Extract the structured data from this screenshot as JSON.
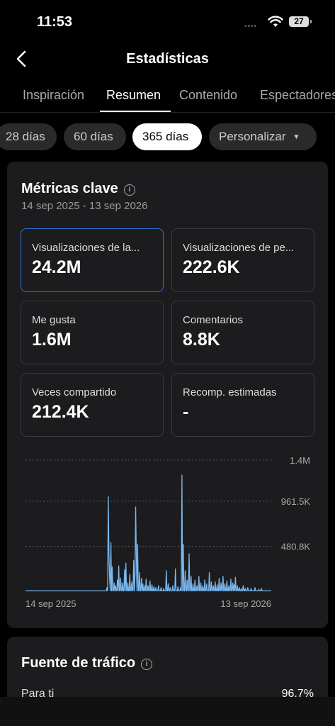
{
  "status": {
    "time": "11:53",
    "battery": "27"
  },
  "header": {
    "title": "Estadísticas"
  },
  "tabs": [
    {
      "label": "Inspiración",
      "active": false
    },
    {
      "label": "Resumen",
      "active": true
    },
    {
      "label": "Contenido",
      "active": false
    },
    {
      "label": "Espectadores",
      "active": false
    }
  ],
  "periods": [
    {
      "label": "28 días",
      "active": false
    },
    {
      "label": "60 días",
      "active": false
    },
    {
      "label": "365 días",
      "active": true
    },
    {
      "label": "Personalizar",
      "active": false
    }
  ],
  "metrics": {
    "title": "Métricas clave",
    "date_range": "14 sep 2025 - 13 sep 2026",
    "tiles": [
      {
        "label": "Visualizaciones de la...",
        "value": "24.2M"
      },
      {
        "label": "Visualizaciones de pe...",
        "value": "222.6K"
      },
      {
        "label": "Me gusta",
        "value": "1.6M"
      },
      {
        "label": "Comentarios",
        "value": "8.8K"
      },
      {
        "label": "Veces compartido",
        "value": "212.4K"
      },
      {
        "label": "Recomp. estimadas",
        "value": "-"
      }
    ]
  },
  "chart_data": {
    "type": "line",
    "y_ticks": [
      "1.4M",
      "961.5K",
      "480.8K"
    ],
    "x_labels": [
      "14 sep 2025",
      "13 sep 2026"
    ],
    "ylim": [
      0,
      1400000
    ],
    "values": [
      5000,
      5000,
      5000,
      5000,
      5000,
      5000,
      5000,
      5000,
      5000,
      5000,
      5000,
      5000,
      5000,
      5000,
      5000,
      5000,
      5000,
      5000,
      5000,
      5000,
      5000,
      5000,
      5000,
      5000,
      5000,
      5000,
      5000,
      5000,
      5000,
      5000,
      5000,
      5000,
      5000,
      5000,
      5000,
      5000,
      5000,
      5000,
      5000,
      5000,
      5000,
      5000,
      5000,
      5000,
      5000,
      5000,
      5000,
      5000,
      5000,
      5000,
      5000,
      5000,
      5000,
      5000,
      5000,
      5000,
      5000,
      5000,
      5000,
      5000,
      5000,
      5000,
      5000,
      5000,
      5000,
      5000,
      5000,
      5000,
      5000,
      5000,
      5000,
      5000,
      5000,
      5000,
      5000,
      5000,
      5000,
      5000,
      5000,
      5000,
      5000,
      5000,
      5000,
      5000,
      5000,
      5000,
      5000,
      5000,
      5000,
      5000,
      5000,
      5000,
      5000,
      5000,
      5000,
      5000,
      5000,
      5000,
      5000,
      5000,
      5000,
      5000,
      5000,
      5000,
      5000,
      5000,
      5000,
      5000,
      5000,
      5000,
      5000,
      5000,
      5000,
      5000,
      5000,
      5000,
      5000,
      5000,
      5000,
      5000,
      5000,
      5000,
      5000,
      5000,
      5000,
      5000,
      5000,
      5000,
      5000,
      5000,
      5000,
      5000,
      5000,
      5000,
      5000,
      5000,
      5000,
      5000,
      5000,
      5000,
      5000,
      5000,
      5000,
      5000,
      5000,
      5000,
      5000,
      5000,
      5000,
      5000,
      5000,
      5000,
      5000,
      5000,
      5000,
      5000,
      5000,
      5000,
      5000,
      5000,
      5000,
      5000,
      5000,
      5000,
      5000,
      5000,
      5000,
      5000,
      5000,
      5000,
      5000,
      5000,
      5000,
      5000,
      5000,
      5000,
      5000,
      5000,
      5000,
      5000,
      5000,
      5000,
      5000,
      5000,
      5000,
      5000,
      5000,
      5000,
      5000,
      5000,
      5000,
      5000,
      5000,
      5000,
      5000,
      5000,
      5000,
      5000,
      5000,
      5000,
      5000,
      5000,
      5000,
      5000,
      5000,
      5000,
      5000,
      5000,
      5000,
      5000,
      5000,
      5000,
      5000,
      5000,
      5000,
      5000,
      5000,
      5000,
      5000,
      5000,
      5000,
      5000,
      5000,
      5000,
      5000,
      5000,
      5000,
      5000,
      5000,
      5000,
      5000,
      5000,
      5000,
      5000,
      5000,
      5000,
      5000,
      5000,
      5000,
      5000,
      5000,
      5000,
      5000,
      5000,
      5000,
      5000,
      5000,
      5000,
      5000,
      5000,
      5000,
      5000,
      5000,
      5000,
      5000,
      5000,
      5000,
      5000,
      5000,
      5000,
      5000,
      5000,
      5000,
      5000,
      5000,
      5000,
      5000,
      5000,
      5000,
      5000,
      5000,
      5000,
      5000,
      5000,
      5000,
      5000,
      5000,
      5000,
      5000,
      5000,
      5000,
      5000,
      5000,
      5000,
      5000,
      5000,
      5000,
      5000,
      5000,
      5000,
      5000,
      5000,
      5000,
      5000,
      5000,
      5000,
      5000,
      5000,
      5000,
      5000,
      5000,
      5000,
      5000,
      5000,
      5000,
      5000,
      5000,
      5000,
      5000,
      5000,
      5000,
      5000,
      5000,
      5000,
      5000,
      5000,
      5000,
      5000,
      5000,
      5000,
      5000,
      5000,
      5000,
      5000,
      5000,
      5000,
      5000,
      5000,
      5000,
      5000,
      5000,
      5000,
      5000,
      5000,
      5000,
      5000,
      5000,
      5000,
      5000,
      5000,
      5000,
      5000,
      5000,
      5000,
      5000,
      5000,
      5000,
      5000,
      5000,
      5000,
      5000,
      5000,
      5000,
      5000,
      5000,
      5000,
      5000,
      5000,
      5000,
      5000,
      5000,
      5000,
      5000,
      5000,
      5000,
      5000,
      5000,
      5000,
      5000,
      5000,
      5000,
      5000,
      5000,
      5000,
      5000,
      5000,
      5000,
      5000
    ],
    "peaks": [
      {
        "day": 125,
        "v": 40000
      },
      {
        "day": 127,
        "v": 1010000
      },
      {
        "day": 128,
        "v": 380000
      },
      {
        "day": 129,
        "v": 150000
      },
      {
        "day": 131,
        "v": 520000
      },
      {
        "day": 133,
        "v": 260000
      },
      {
        "day": 136,
        "v": 90000
      },
      {
        "day": 138,
        "v": 60000
      },
      {
        "day": 141,
        "v": 120000
      },
      {
        "day": 143,
        "v": 270000
      },
      {
        "day": 146,
        "v": 140000
      },
      {
        "day": 149,
        "v": 90000
      },
      {
        "day": 152,
        "v": 230000
      },
      {
        "day": 154,
        "v": 300000
      },
      {
        "day": 157,
        "v": 90000
      },
      {
        "day": 160,
        "v": 180000
      },
      {
        "day": 163,
        "v": 100000
      },
      {
        "day": 166,
        "v": 330000
      },
      {
        "day": 168,
        "v": 180000
      },
      {
        "day": 169,
        "v": 900000
      },
      {
        "day": 170,
        "v": 400000
      },
      {
        "day": 172,
        "v": 500000
      },
      {
        "day": 175,
        "v": 200000
      },
      {
        "day": 178,
        "v": 140000
      },
      {
        "day": 180,
        "v": 80000
      },
      {
        "day": 183,
        "v": 60000
      },
      {
        "day": 185,
        "v": 130000
      },
      {
        "day": 188,
        "v": 60000
      },
      {
        "day": 191,
        "v": 110000
      },
      {
        "day": 194,
        "v": 70000
      },
      {
        "day": 197,
        "v": 50000
      },
      {
        "day": 200,
        "v": 40000
      },
      {
        "day": 204,
        "v": 60000
      },
      {
        "day": 208,
        "v": 40000
      },
      {
        "day": 212,
        "v": 30000
      },
      {
        "day": 216,
        "v": 220000
      },
      {
        "day": 219,
        "v": 80000
      },
      {
        "day": 222,
        "v": 40000
      },
      {
        "day": 226,
        "v": 60000
      },
      {
        "day": 230,
        "v": 240000
      },
      {
        "day": 234,
        "v": 50000
      },
      {
        "day": 238,
        "v": 40000
      },
      {
        "day": 240,
        "v": 1240000
      },
      {
        "day": 242,
        "v": 500000
      },
      {
        "day": 245,
        "v": 220000
      },
      {
        "day": 248,
        "v": 120000
      },
      {
        "day": 251,
        "v": 400000
      },
      {
        "day": 254,
        "v": 160000
      },
      {
        "day": 257,
        "v": 80000
      },
      {
        "day": 260,
        "v": 120000
      },
      {
        "day": 263,
        "v": 60000
      },
      {
        "day": 266,
        "v": 160000
      },
      {
        "day": 269,
        "v": 90000
      },
      {
        "day": 272,
        "v": 60000
      },
      {
        "day": 275,
        "v": 120000
      },
      {
        "day": 278,
        "v": 80000
      },
      {
        "day": 282,
        "v": 200000
      },
      {
        "day": 285,
        "v": 100000
      },
      {
        "day": 288,
        "v": 60000
      },
      {
        "day": 291,
        "v": 100000
      },
      {
        "day": 294,
        "v": 70000
      },
      {
        "day": 297,
        "v": 140000
      },
      {
        "day": 300,
        "v": 90000
      },
      {
        "day": 303,
        "v": 160000
      },
      {
        "day": 306,
        "v": 80000
      },
      {
        "day": 309,
        "v": 110000
      },
      {
        "day": 312,
        "v": 60000
      },
      {
        "day": 315,
        "v": 130000
      },
      {
        "day": 318,
        "v": 90000
      },
      {
        "day": 320,
        "v": 70000
      },
      {
        "day": 322,
        "v": 150000
      },
      {
        "day": 325,
        "v": 60000
      },
      {
        "day": 328,
        "v": 40000
      },
      {
        "day": 331,
        "v": 30000
      },
      {
        "day": 334,
        "v": 60000
      },
      {
        "day": 337,
        "v": 30000
      },
      {
        "day": 341,
        "v": 40000
      },
      {
        "day": 346,
        "v": 30000
      },
      {
        "day": 352,
        "v": 40000
      },
      {
        "day": 358,
        "v": 20000
      },
      {
        "day": 362,
        "v": 30000
      }
    ],
    "grid": true
  },
  "traffic": {
    "title": "Fuente de tráfico",
    "row_label": "Para ti",
    "row_value": "96.7%"
  },
  "colors": {
    "accent": "#2b6fd6",
    "line": "#7ab8f0"
  }
}
